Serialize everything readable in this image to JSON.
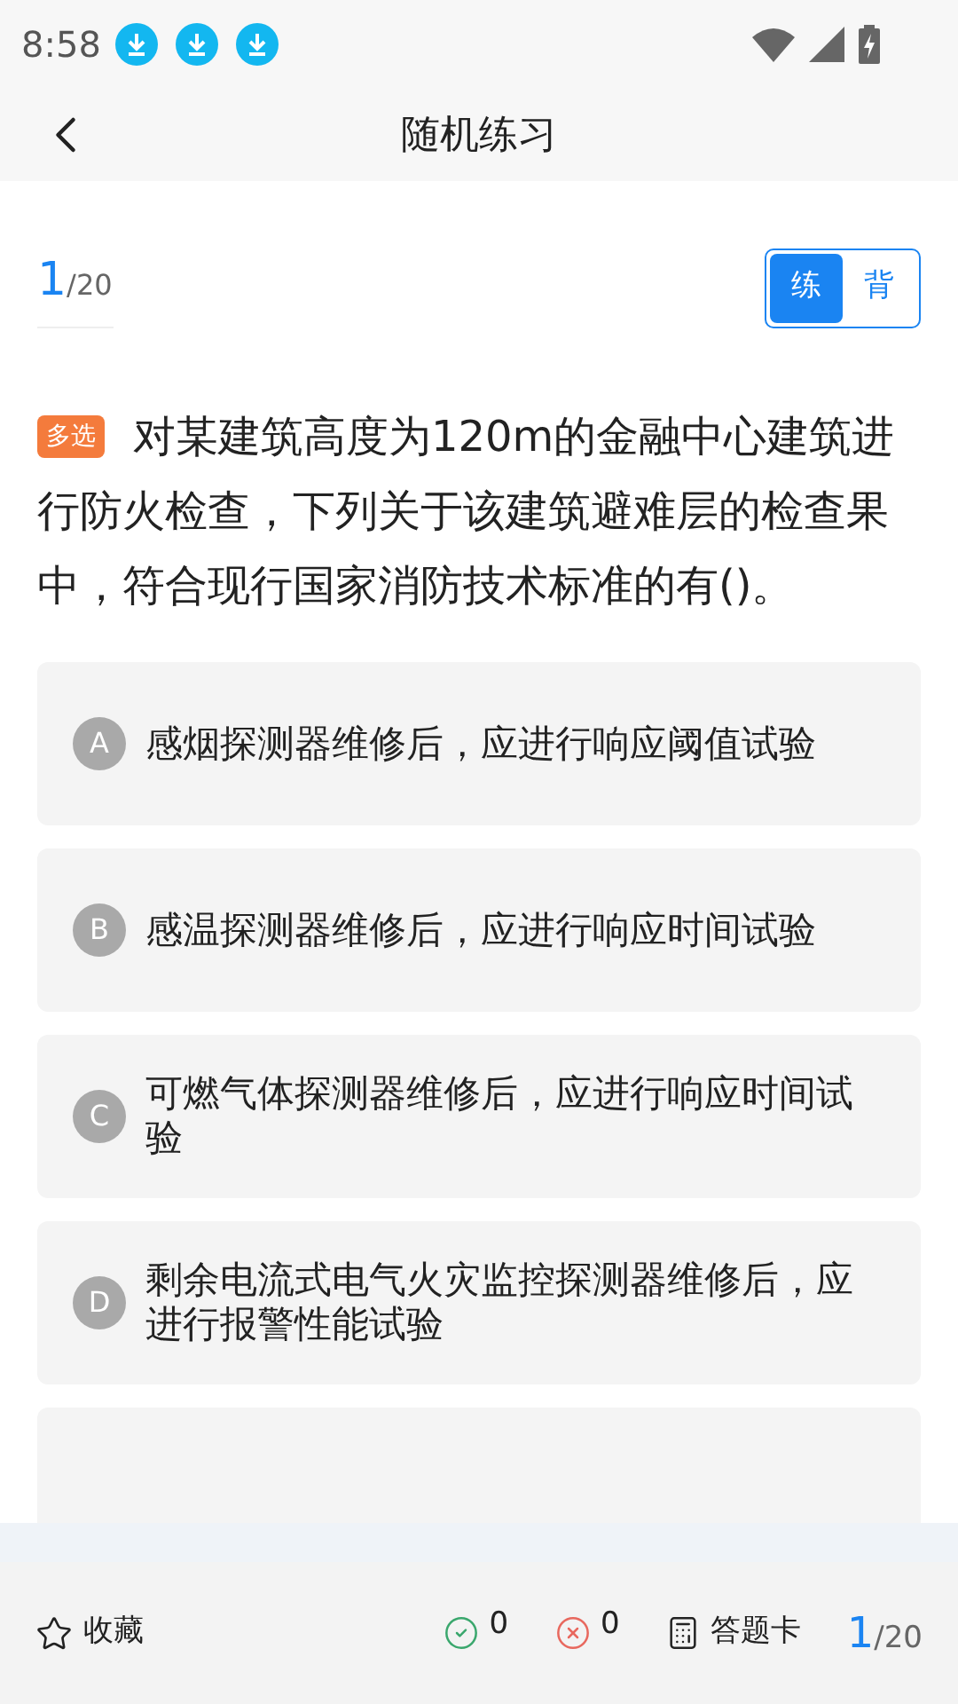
{
  "status_bar": {
    "time": "8:58"
  },
  "nav": {
    "title": "随机练习"
  },
  "progress": {
    "current": "1",
    "total": "/20"
  },
  "mode_tabs": [
    {
      "label": "练",
      "selected": true
    },
    {
      "label": "背",
      "selected": false
    }
  ],
  "question": {
    "tag": "多选",
    "text": "对某建筑高度为120m的金融中心建筑进行防火检查，下列关于该建筑避难层的检查果中，符合现行国家消防技术标准的有()。"
  },
  "options": [
    {
      "letter": "A",
      "text": "感烟探测器维修后，应进行响应阈值试验"
    },
    {
      "letter": "B",
      "text": "感温探测器维修后，应进行响应时间试验"
    },
    {
      "letter": "C",
      "text": "可燃气体探测器维修后，应进行响应时间试验"
    },
    {
      "letter": "D",
      "text": "剩余电流式电气火灾监控探测器维修后，应进行报警性能试验"
    },
    {
      "kind": "hidden"
    }
  ],
  "bottom_bar": {
    "favorite": "收藏",
    "correct": "0",
    "wrong": "0",
    "answer_card": "答题卡",
    "current": "1",
    "total": "/20"
  }
}
